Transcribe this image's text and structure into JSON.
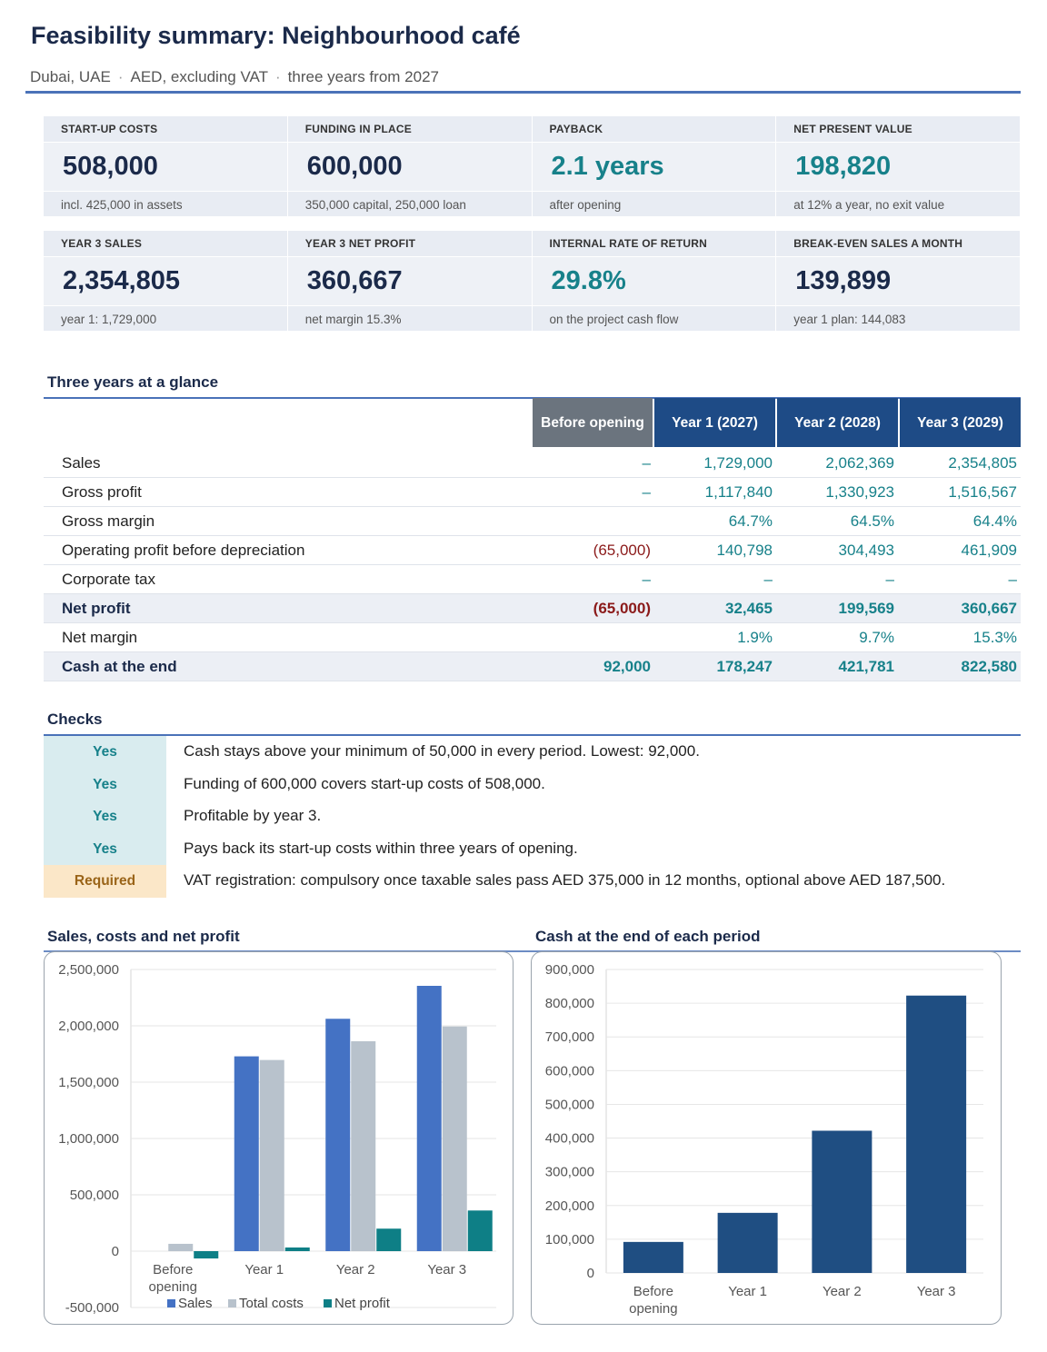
{
  "header": {
    "title": "Feasibility summary: Neighbourhood café",
    "subtitle_parts": [
      "Dubai, UAE",
      "AED, excluding VAT",
      "three years from 2027"
    ],
    "subtitle_separator": "·"
  },
  "kpis": [
    {
      "label": "START-UP COSTS",
      "value": "508,000",
      "note": "incl. 425,000 in assets",
      "accent": false
    },
    {
      "label": "FUNDING IN PLACE",
      "value": "600,000",
      "note": "350,000 capital, 250,000 loan",
      "accent": false
    },
    {
      "label": "PAYBACK",
      "value": "2.1 years",
      "note": "after opening",
      "accent": true
    },
    {
      "label": "NET PRESENT VALUE",
      "value": "198,820",
      "note": "at 12% a year, no exit value",
      "accent": true
    },
    {
      "label": "YEAR 3 SALES",
      "value": "2,354,805",
      "note": "year 1: 1,729,000",
      "accent": false
    },
    {
      "label": "YEAR 3 NET PROFIT",
      "value": "360,667",
      "note": "net margin 15.3%",
      "accent": false
    },
    {
      "label": "INTERNAL RATE OF RETURN",
      "value": "29.8%",
      "note": "on the project cash flow",
      "accent": true
    },
    {
      "label": "BREAK-EVEN SALES A MONTH",
      "value": "139,899",
      "note": "year 1 plan: 144,083",
      "accent": false
    }
  ],
  "glance": {
    "title": "Three years at a glance",
    "columns": [
      "Before opening",
      "Year 1 (2027)",
      "Year 2 (2028)",
      "Year 3 (2029)"
    ],
    "rows": [
      {
        "label": "Sales",
        "values": [
          "–",
          "1,729,000",
          "2,062,369",
          "2,354,805"
        ],
        "bold": false
      },
      {
        "label": "Gross profit",
        "values": [
          "–",
          "1,117,840",
          "1,330,923",
          "1,516,567"
        ],
        "bold": false
      },
      {
        "label": "Gross margin",
        "values": [
          "",
          "64.7%",
          "64.5%",
          "64.4%"
        ],
        "bold": false
      },
      {
        "label": "Operating profit before depreciation",
        "values": [
          "(65,000)",
          "140,798",
          "304,493",
          "461,909"
        ],
        "bold": false
      },
      {
        "label": "Corporate tax",
        "values": [
          "–",
          "–",
          "–",
          "–"
        ],
        "bold": false
      },
      {
        "label": "Net profit",
        "values": [
          "(65,000)",
          "32,465",
          "199,569",
          "360,667"
        ],
        "bold": true
      },
      {
        "label": "Net margin",
        "values": [
          "",
          "1.9%",
          "9.7%",
          "15.3%"
        ],
        "bold": false
      },
      {
        "label": "Cash at the end",
        "values": [
          "92,000",
          "178,247",
          "421,781",
          "822,580"
        ],
        "bold": true
      }
    ]
  },
  "checks": {
    "title": "Checks",
    "items": [
      {
        "status": "Yes",
        "kind": "ok",
        "text": "Cash stays above your minimum of 50,000 in every period. Lowest: 92,000."
      },
      {
        "status": "Yes",
        "kind": "ok",
        "text": "Funding of 600,000 covers start-up costs of 508,000."
      },
      {
        "status": "Yes",
        "kind": "ok",
        "text": "Profitable by year 3."
      },
      {
        "status": "Yes",
        "kind": "ok",
        "text": "Pays back its start-up costs within three years of opening."
      },
      {
        "status": "Required",
        "kind": "required",
        "text": "VAT registration: compulsory once taxable sales pass AED 375,000 in 12 months, optional above AED 187,500."
      }
    ]
  },
  "colors": {
    "sales": "#4472c4",
    "total_costs": "#b8c2cc",
    "net_profit": "#0e7f86",
    "cash": "#1f4e82",
    "grid": "#e6e6e6",
    "axis_text": "#555555"
  },
  "chart_data": [
    {
      "type": "bar",
      "title": "Sales, costs and net profit",
      "categories": [
        "Before opening",
        "Year 1",
        "Year 2",
        "Year 3"
      ],
      "series": [
        {
          "name": "Sales",
          "values": [
            0,
            1729000,
            2062369,
            2354805
          ]
        },
        {
          "name": "Total costs",
          "values": [
            65000,
            1696535,
            1862800,
            1994138
          ]
        },
        {
          "name": "Net profit",
          "values": [
            -65000,
            32465,
            199569,
            360667
          ]
        }
      ],
      "ylim": [
        -500000,
        2500000
      ],
      "yticks": [
        "-500,000",
        "0",
        "500,000",
        "1,000,000",
        "1,500,000",
        "2,000,000",
        "2,500,000"
      ],
      "legend": "bottom",
      "grid": true
    },
    {
      "type": "bar",
      "title": "Cash at the end of each period",
      "categories": [
        "Before opening",
        "Year 1",
        "Year 2",
        "Year 3"
      ],
      "values": [
        92000,
        178247,
        421781,
        822580
      ],
      "ylim": [
        0,
        900000
      ],
      "yticks": [
        "0",
        "100,000",
        "200,000",
        "300,000",
        "400,000",
        "500,000",
        "600,000",
        "700,000",
        "800,000",
        "900,000"
      ],
      "grid": true
    }
  ]
}
